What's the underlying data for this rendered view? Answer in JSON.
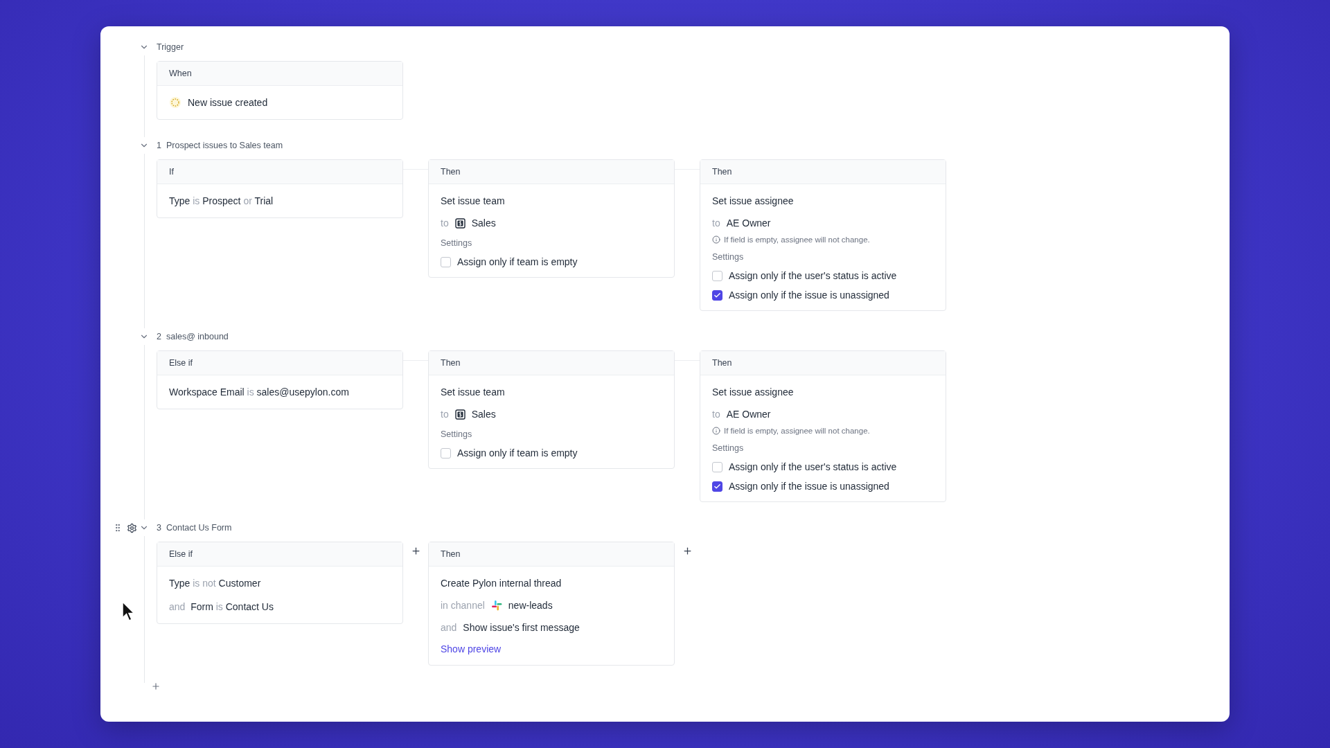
{
  "sections": [
    {
      "kind": "trigger",
      "label": "Trigger",
      "expanded": true,
      "hovered": false,
      "cards": [
        {
          "kind": "trigger",
          "header": "When",
          "event": "New issue created"
        }
      ]
    },
    {
      "kind": "rule",
      "number": "1",
      "label": "Prospect issues to Sales team",
      "expanded": true,
      "hovered": false,
      "cards": [
        {
          "kind": "condition",
          "header": "If",
          "lines": [
            [
              {
                "text": "Type",
                "muted": false
              },
              {
                "text": "is",
                "muted": true
              },
              {
                "text": "Prospect",
                "muted": false
              },
              {
                "text": "or",
                "muted": true
              },
              {
                "text": "Trial",
                "muted": false
              }
            ]
          ]
        },
        {
          "kind": "action",
          "header": "Then",
          "title": "Set issue team",
          "rows": [
            {
              "kind": "team",
              "prefix": "to",
              "value": "Sales"
            }
          ],
          "settings_label": "Settings",
          "settings": [
            {
              "label": "Assign only if team is empty",
              "checked": false
            }
          ]
        },
        {
          "kind": "action",
          "header": "Then",
          "title": "Set issue assignee",
          "rows": [
            {
              "kind": "plain",
              "prefix": "to",
              "value": "AE Owner"
            }
          ],
          "note": "If field is empty, assignee will not change.",
          "settings_label": "Settings",
          "settings": [
            {
              "label": "Assign only if the user's status is active",
              "checked": false
            },
            {
              "label": "Assign only if the issue is unassigned",
              "checked": true
            }
          ]
        }
      ]
    },
    {
      "kind": "rule",
      "number": "2",
      "label": "sales@ inbound",
      "expanded": true,
      "hovered": false,
      "cards": [
        {
          "kind": "condition",
          "header": "Else if",
          "lines": [
            [
              {
                "text": "Workspace Email",
                "muted": false
              },
              {
                "text": "is",
                "muted": true
              },
              {
                "text": "sales@usepylon.com",
                "muted": false
              }
            ]
          ]
        },
        {
          "kind": "action",
          "header": "Then",
          "title": "Set issue team",
          "rows": [
            {
              "kind": "team",
              "prefix": "to",
              "value": "Sales"
            }
          ],
          "settings_label": "Settings",
          "settings": [
            {
              "label": "Assign only if team is empty",
              "checked": false
            }
          ]
        },
        {
          "kind": "action",
          "header": "Then",
          "title": "Set issue assignee",
          "rows": [
            {
              "kind": "plain",
              "prefix": "to",
              "value": "AE Owner"
            }
          ],
          "note": "If field is empty, assignee will not change.",
          "settings_label": "Settings",
          "settings": [
            {
              "label": "Assign only if the user's status is active",
              "checked": false
            },
            {
              "label": "Assign only if the issue is unassigned",
              "checked": true
            }
          ]
        }
      ]
    },
    {
      "kind": "rule",
      "number": "3",
      "label": "Contact Us Form",
      "expanded": true,
      "hovered": true,
      "cards": [
        {
          "kind": "condition",
          "header": "Else if",
          "lines": [
            [
              {
                "text": "Type",
                "muted": false
              },
              {
                "text": "is not",
                "muted": true
              },
              {
                "text": "Customer",
                "muted": false
              }
            ],
            [
              {
                "text": "and",
                "muted": true
              },
              {
                "text": "Form",
                "muted": false
              },
              {
                "text": "is",
                "muted": true
              },
              {
                "text": "Contact Us",
                "muted": false
              }
            ]
          ]
        },
        {
          "kind": "action",
          "header": "Then",
          "title": "Create Pylon internal thread",
          "rows": [
            {
              "kind": "channel",
              "prefix": "in channel",
              "value": "new-leads"
            },
            {
              "kind": "plain",
              "prefix": "and",
              "value": "Show issue's first message"
            }
          ],
          "link": "Show preview"
        }
      ]
    }
  ]
}
